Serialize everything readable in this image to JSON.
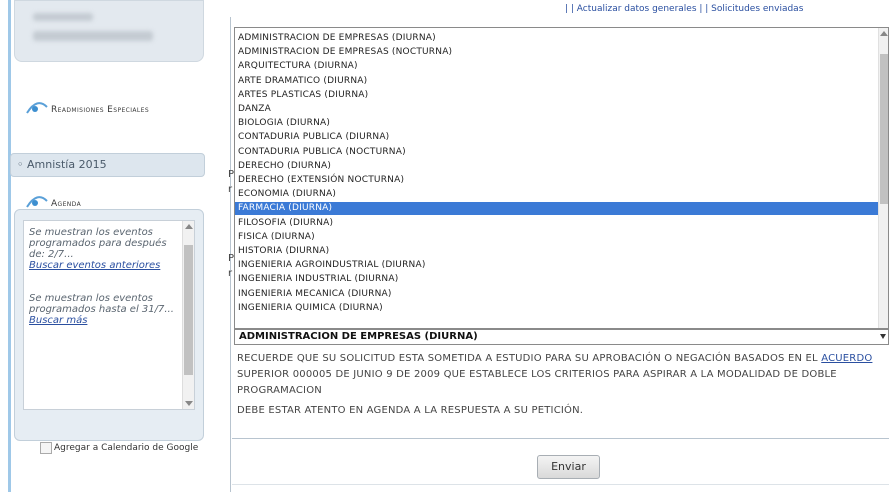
{
  "sidebar": {
    "section1_title": "Readmisiones Especiales",
    "section1_item": "Amnistía 2015",
    "agenda_title": "Agenda",
    "agenda": {
      "entry1_text": "Se muestran los eventos programados para después de: 2/7...",
      "entry1_link": "Buscar eventos anteriores",
      "entry2_text": "Se muestran los eventos programados hasta el 31/7...",
      "entry2_link": "Buscar más"
    },
    "google_calendar_link": "Agregar a Calendario de Google"
  },
  "top_links": "| | Actualizar datos generales | | Solicitudes enviadas",
  "programs": [
    "ADMINISTRACION DE EMPRESAS (DIURNA)",
    "ADMINISTRACION DE EMPRESAS (NOCTURNA)",
    "ARQUITECTURA (DIURNA)",
    "ARTE DRAMATICO (DIURNA)",
    "ARTES PLASTICAS (DIURNA)",
    "DANZA",
    "BIOLOGIA (DIURNA)",
    "CONTADURIA PUBLICA (DIURNA)",
    "CONTADURIA PUBLICA (NOCTURNA)",
    "DERECHO (DIURNA)",
    "DERECHO (EXTENSIÓN NOCTURNA)",
    "ECONOMIA (DIURNA)",
    "FARMACIA (DIURNA)",
    "FILOSOFIA (DIURNA)",
    "FISICA (DIURNA)",
    "HISTORIA (DIURNA)",
    "INGENIERIA AGROINDUSTRIAL (DIURNA)",
    "INGENIERIA INDUSTRIAL (DIURNA)",
    "INGENIERIA MECANICA (DIURNA)",
    "INGENIERIA QUIMICA (DIURNA)"
  ],
  "selected_index": 12,
  "select_value": "ADMINISTRACION DE EMPRESAS (DIURNA)",
  "notice": {
    "text": "RECUERDE QUE SU SOLICITUD ESTA SOMETIDA A ESTUDIO PARA SU APROBACIÓN O NEGACIÓN BASADOS EN EL",
    "link": "ACUERDO",
    "text2": "SUPERIOR 000005 DE JUNIO 9 DE 2009 QUE ESTABLECE LOS CRITERIOS PARA ASPIRAR A LA MODALIDAD DE DOBLE PROGRAMACION",
    "footer": "DEBE ESTAR ATENTO EN AGENDA A LA RESPUESTA A SU PETICIÓN."
  },
  "partial_letters": [
    "P",
    "r",
    "P",
    "r"
  ],
  "submit_label": "Enviar",
  "colors": {
    "selected_bg": "#3b7ad6",
    "link": "#2a4fa0",
    "accent": "#9fc8e8"
  }
}
